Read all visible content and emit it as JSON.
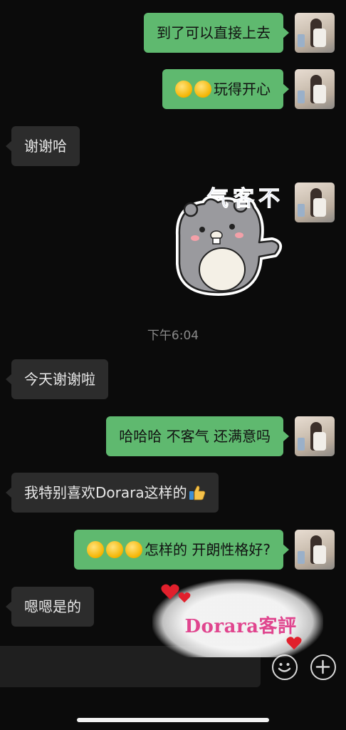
{
  "messages": [
    {
      "side": "out",
      "text": "到了可以直接上去",
      "emoji_count": 0
    },
    {
      "side": "out",
      "text": "玩得开心",
      "emoji_count": 2,
      "emoji_name": "grinning-hand-over-mouth-emoji"
    },
    {
      "side": "in",
      "text": "谢谢哈"
    },
    {
      "side": "out",
      "sticker": {
        "name": "hamster-sticker",
        "caption": "不客气"
      }
    },
    {
      "side": "in",
      "text": "今天谢谢啦"
    },
    {
      "side": "out",
      "text": "哈哈哈 不客气 还满意吗",
      "emoji_count": 0
    },
    {
      "side": "in",
      "text": "我特别喜欢Dorara这样的",
      "trailing_emoji": "thumbs-up-emoji"
    },
    {
      "side": "out",
      "text": "怎样的 开朗性格好?",
      "emoji_count": 3,
      "emoji_name": "grinning-hand-over-mouth-emoji"
    },
    {
      "side": "in",
      "text": "嗯嗯是的"
    }
  ],
  "timestamp": "下午6:04",
  "watermark": {
    "text": "Dorara客評",
    "color": "#e0458e"
  },
  "input_bar": {
    "emoji_icon": "smiley-icon",
    "add_icon": "plus-circle-icon"
  },
  "colors": {
    "outgoing_bubble": "#5fb96f",
    "incoming_bubble": "#2c2c2c",
    "background": "#0b0b0b"
  }
}
